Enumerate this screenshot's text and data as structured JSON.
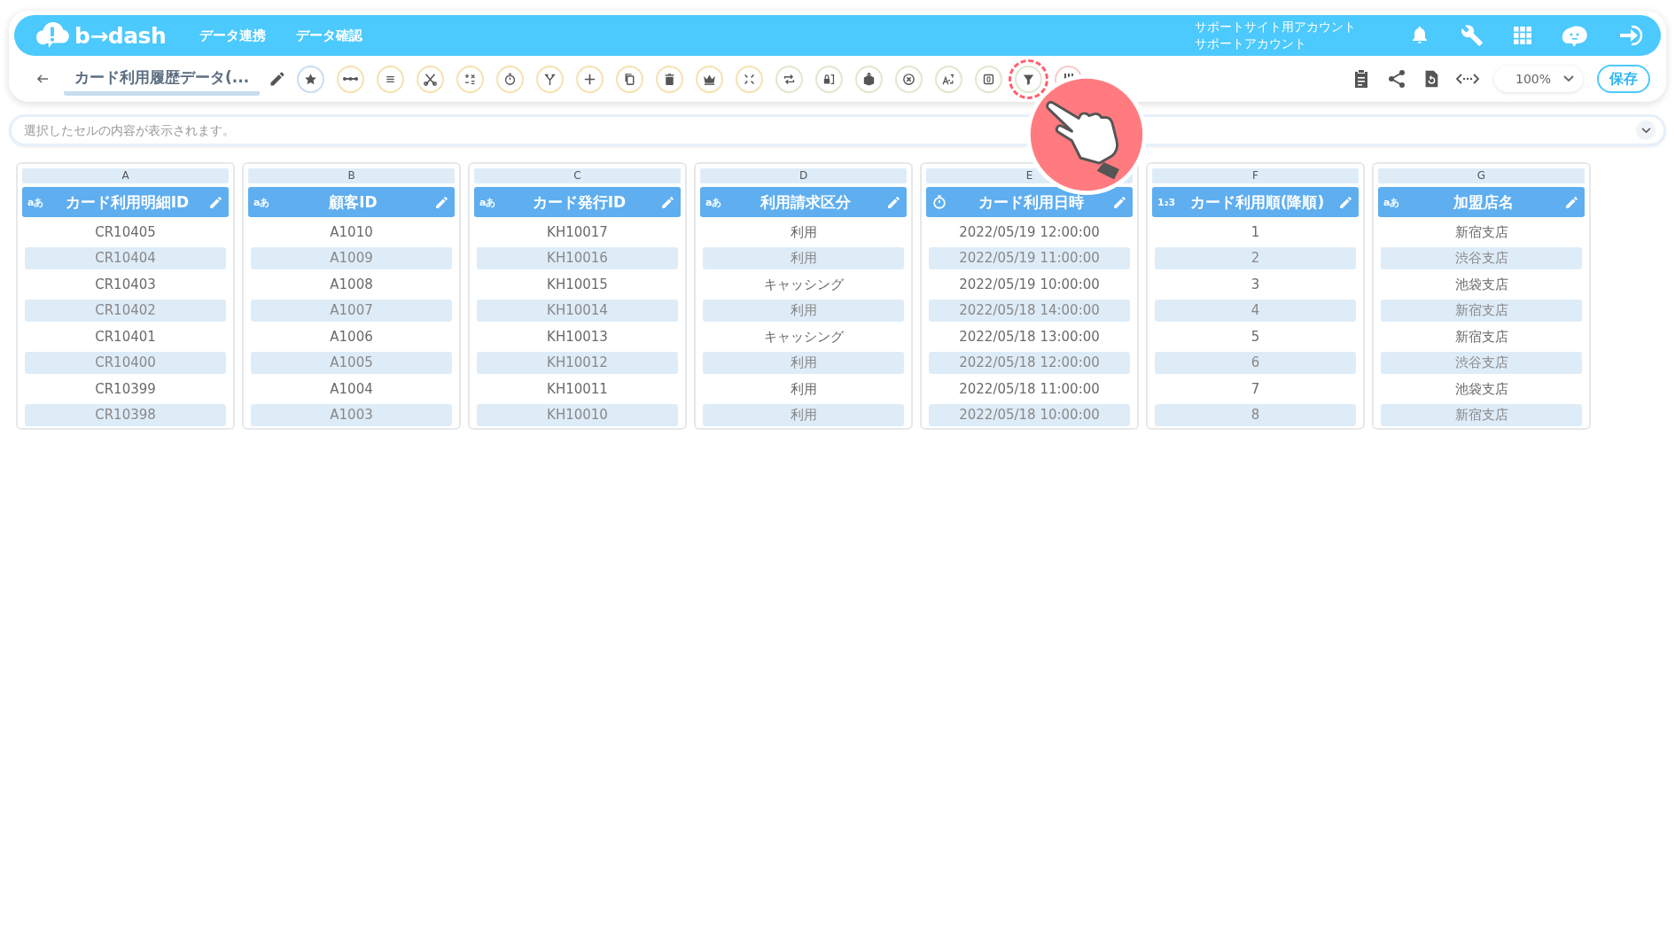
{
  "header": {
    "logo": "b→dash",
    "nav": [
      {
        "label": "データ連携"
      },
      {
        "label": "データ確認"
      }
    ],
    "account": {
      "line1": "サポートサイト用アカウント",
      "line2": "サポートアカウント"
    }
  },
  "toolbar": {
    "title": "カード利用履歴データ(...",
    "tools": [
      {
        "highlighted": false
      },
      {
        "highlighted": false
      },
      {
        "highlighted": false
      },
      {
        "highlighted": false
      },
      {
        "highlighted": false
      },
      {
        "highlighted": false
      },
      {
        "highlighted": false
      },
      {
        "highlighted": false
      },
      {
        "highlighted": false
      },
      {
        "highlighted": false
      },
      {
        "highlighted": false
      },
      {
        "highlighted": false
      },
      {
        "highlighted": false
      },
      {
        "highlighted": false
      },
      {
        "highlighted": false
      },
      {
        "highlighted": false
      },
      {
        "highlighted": false
      },
      {
        "highlighted": false
      },
      {
        "highlighted": true
      },
      {
        "highlighted": false
      }
    ],
    "zoom": "100%",
    "save": "保存"
  },
  "cell_bar": {
    "placeholder": "選択したセルの内容が表示されます。"
  },
  "columns": [
    {
      "letter": "A",
      "kind": "text",
      "type_label": "aあ",
      "name": "カード利用明細ID",
      "cells": [
        "CR10405",
        "CR10404",
        "CR10403",
        "CR10402",
        "CR10401",
        "CR10400",
        "CR10399",
        "CR10398"
      ]
    },
    {
      "letter": "B",
      "kind": "text",
      "type_label": "aあ",
      "name": "顧客ID",
      "cells": [
        "A1010",
        "A1009",
        "A1008",
        "A1007",
        "A1006",
        "A1005",
        "A1004",
        "A1003"
      ]
    },
    {
      "letter": "C",
      "kind": "text",
      "type_label": "aあ",
      "name": "カード発行ID",
      "cells": [
        "KH10017",
        "KH10016",
        "KH10015",
        "KH10014",
        "KH10013",
        "KH10012",
        "KH10011",
        "KH10010"
      ]
    },
    {
      "letter": "D",
      "kind": "text",
      "type_label": "aあ",
      "name": "利用請求区分",
      "cells": [
        "利用",
        "利用",
        "キャッシング",
        "利用",
        "キャッシング",
        "利用",
        "利用",
        "利用"
      ]
    },
    {
      "letter": "E",
      "kind": "datetime",
      "name": "カード利用日時",
      "cells": [
        "2022/05/19 12:00:00",
        "2022/05/19 11:00:00",
        "2022/05/19 10:00:00",
        "2022/05/18 14:00:00",
        "2022/05/18 13:00:00",
        "2022/05/18 12:00:00",
        "2022/05/18 11:00:00",
        "2022/05/18 10:00:00"
      ]
    },
    {
      "letter": "F",
      "kind": "number",
      "type_label": "1₂3",
      "name": "カード利用順(降順)",
      "cells": [
        "1",
        "2",
        "3",
        "4",
        "5",
        "6",
        "7",
        "8"
      ]
    },
    {
      "letter": "G",
      "kind": "text",
      "type_label": "aあ",
      "name": "加盟店名",
      "cells": [
        "新宿支店",
        "渋谷支店",
        "池袋支店",
        "新宿支店",
        "新宿支店",
        "渋谷支店",
        "池袋支店",
        "新宿支店"
      ]
    }
  ]
}
